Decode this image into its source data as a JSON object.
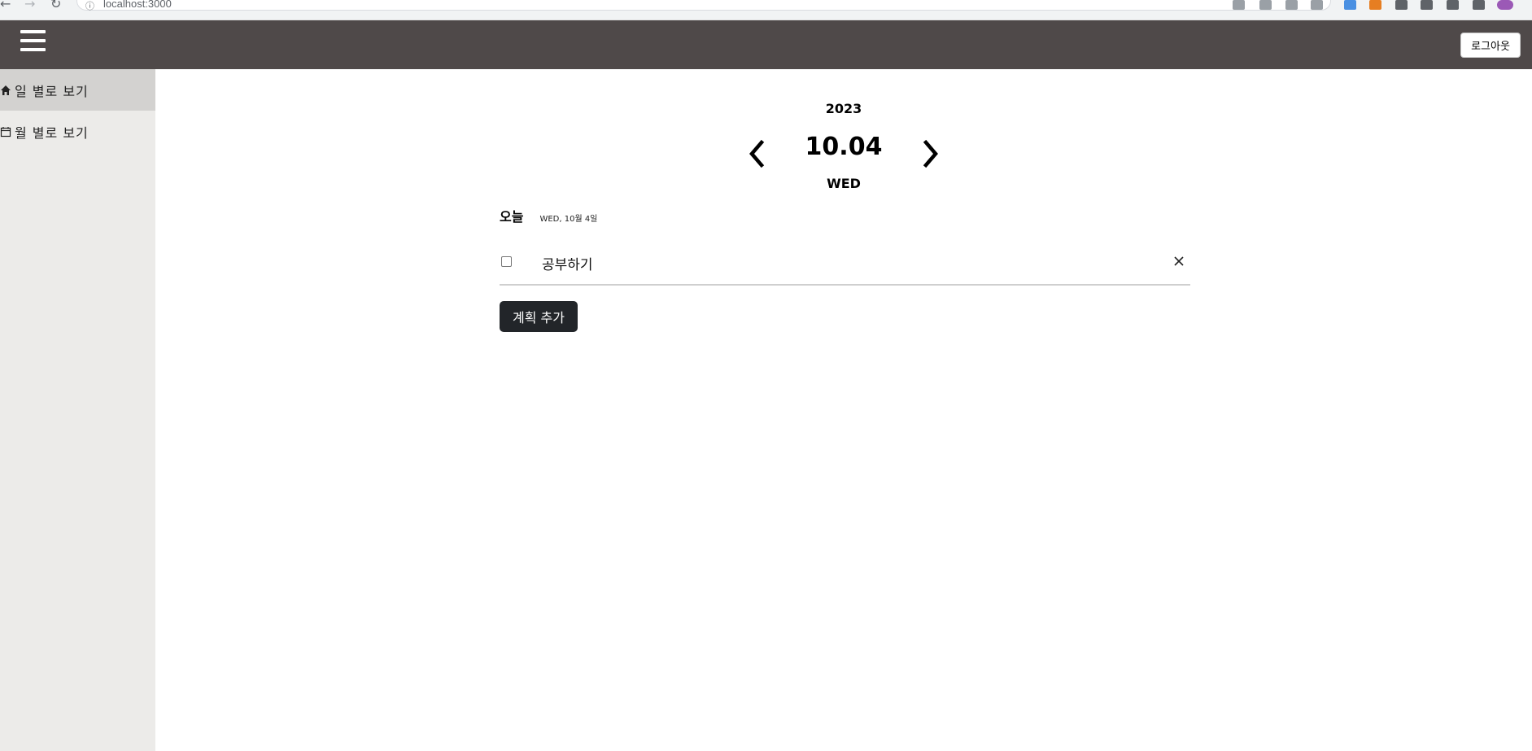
{
  "browser": {
    "url": "localhost:3000"
  },
  "header": {
    "logout_label": "로그아웃"
  },
  "sidebar": {
    "items": [
      {
        "label": "일 별로 보기",
        "icon": "home-icon",
        "active": true
      },
      {
        "label": "월 별로 보기",
        "icon": "calendar-icon",
        "active": false
      }
    ]
  },
  "main": {
    "year": "2023",
    "date": "10.04",
    "weekday": "WED",
    "today_label": "오늘",
    "today_sub": "WED, 10월 4일",
    "todos": [
      {
        "text": "공부하기",
        "checked": false
      }
    ],
    "add_label": "계획 추가"
  },
  "colors": {
    "header_bg": "#4f4949",
    "sidebar_bg": "#ecebe9",
    "sidebar_active_bg": "#d3d2d0",
    "add_button_bg": "#222529"
  }
}
